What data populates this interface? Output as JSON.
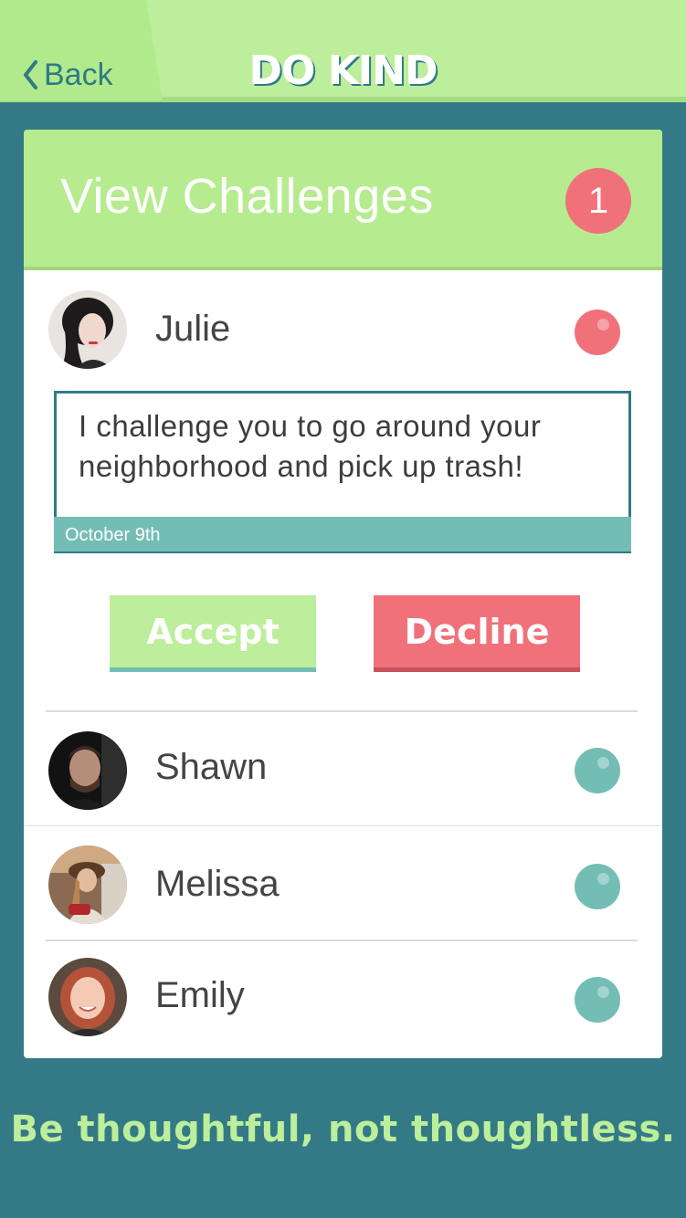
{
  "header": {
    "back_label": "Back",
    "brand": "DO KIND"
  },
  "card": {
    "title": "View Challenges",
    "badge_count": "1"
  },
  "challenges": [
    {
      "name": "Julie",
      "status_color": "#f0717a",
      "expanded": true,
      "message": "I challenge you to go around your neighborhood and pick up trash!",
      "date": "October 9th",
      "accept_label": "Accept",
      "decline_label": "Decline"
    },
    {
      "name": "Shawn",
      "status_color": "#74bdb5"
    },
    {
      "name": "Melissa",
      "status_color": "#74bdb5"
    },
    {
      "name": "Emily",
      "status_color": "#74bdb5"
    }
  ],
  "footer": {
    "tagline": "Be thoughtful, not thoughtless."
  },
  "colors": {
    "background": "#337a86",
    "header": "#bdee9b",
    "accent_green": "#b6ec8f",
    "accent_red": "#f0717a",
    "accent_teal": "#74bdb5"
  }
}
